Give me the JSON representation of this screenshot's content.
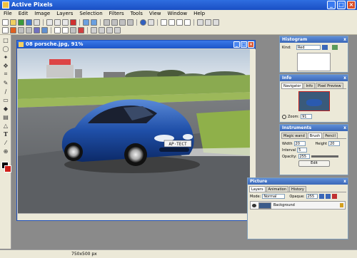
{
  "app": {
    "title": "Active Pixels"
  },
  "menu": [
    "File",
    "Edit",
    "Image",
    "Layers",
    "Selection",
    "Filters",
    "Tools",
    "View",
    "Window",
    "Help"
  ],
  "document": {
    "title": "08 porsche.jpg, 91%",
    "plate_text": "AP·TECT"
  },
  "panels": {
    "histogram": {
      "title": "Histogram",
      "kind_label": "Kind:",
      "kind_value": "Red"
    },
    "info": {
      "title": "Info",
      "tabs": [
        "Navigator",
        "Info",
        "Pixel Preview"
      ],
      "zoom_label": "Zoom:",
      "zoom_value": "91"
    },
    "instruments": {
      "title": "Instruments",
      "tabs": [
        "Magic wand",
        "Brush",
        "Pencil"
      ],
      "width_label": "Width",
      "width_value": "20",
      "height_label": "Height",
      "height_value": "20",
      "interval_label": "Interval",
      "interval_value": "5",
      "opacity_label": "Opacity:",
      "opacity_value": "255",
      "edit_label": "Edit"
    },
    "picture": {
      "title": "Picture",
      "tabs": [
        "Layers",
        "Animation",
        "History"
      ],
      "mode_label": "Mode:",
      "mode_value": "Normal",
      "opaque_label": "Opaque:",
      "opaque_value": "255",
      "layer_name": "Background"
    }
  },
  "status": {
    "size": "750x500 px"
  },
  "colors": {
    "foreground": "#000000",
    "background": "#d0201a",
    "title_bar": "#1a4fc4"
  }
}
